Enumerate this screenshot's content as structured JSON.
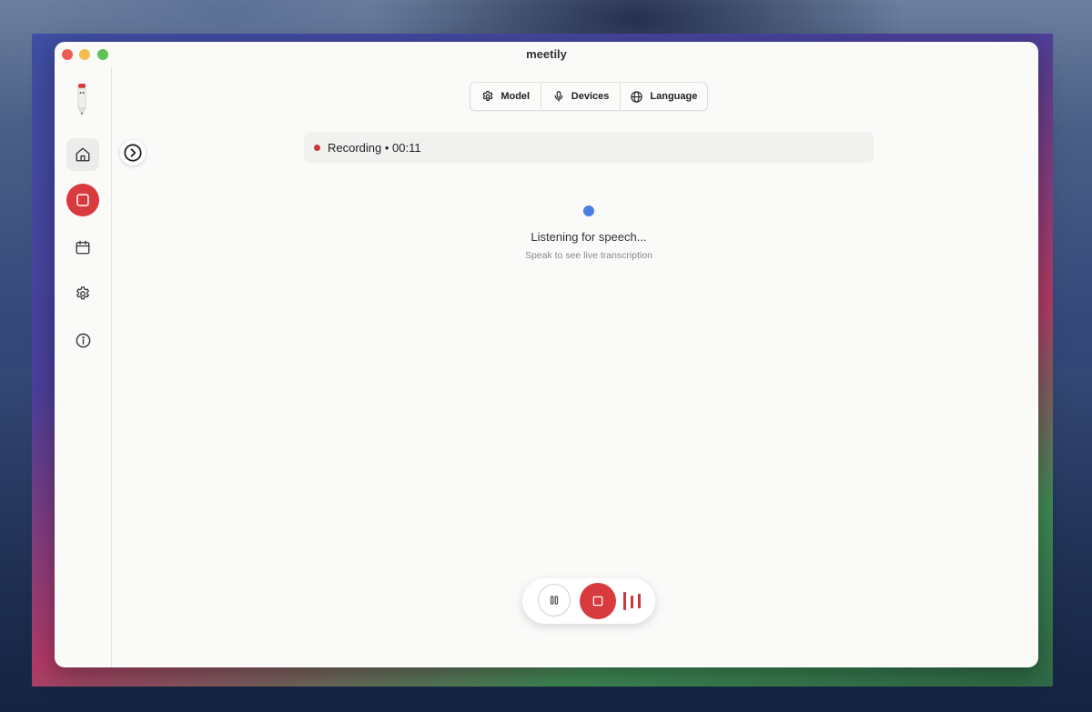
{
  "window": {
    "title": "meetily"
  },
  "sidebar": {
    "items": [
      {
        "name": "home",
        "icon": "home-icon"
      },
      {
        "name": "record",
        "icon": "stop-square-icon"
      },
      {
        "name": "calendar",
        "icon": "calendar-icon"
      },
      {
        "name": "settings",
        "icon": "gear-icon"
      },
      {
        "name": "info",
        "icon": "info-icon"
      }
    ]
  },
  "toolbar": {
    "model_label": "Model",
    "devices_label": "Devices",
    "language_label": "Language"
  },
  "status": {
    "text": "Recording • 00:11"
  },
  "listening": {
    "title": "Listening for speech...",
    "subtitle": "Speak to see live transcription"
  },
  "colors": {
    "accent_red": "#d83a3e",
    "listening_blue": "#4c7de4"
  }
}
